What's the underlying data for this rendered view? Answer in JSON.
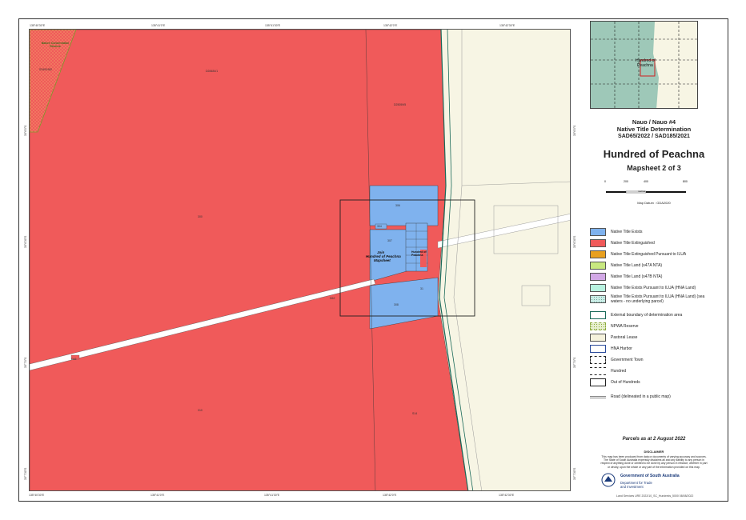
{
  "map": {
    "ticks_top": [
      "135°40'30\"E",
      "135°41'0\"E",
      "135°41'30\"E",
      "135°42'0\"E",
      "135°42'30\"E"
    ],
    "ticks_bottom": [
      "135°40'30\"E",
      "135°41'0\"E",
      "135°41'30\"E",
      "135°42'0\"E",
      "135°42'30\"E"
    ],
    "ticks_left": [
      "33°6'0\"S",
      "33°6'30\"S",
      "33°7'0\"S",
      "33°7'30\"S"
    ],
    "ticks_right": [
      "33°6'0\"S",
      "33°6'30\"S",
      "33°7'0\"S",
      "33°7'30\"S"
    ],
    "parcel_labels": {
      "reserve": "Nature Conservation Reserve",
      "top_left": "S3400462",
      "top_mid": "D28484/1",
      "upper_center": "D25059/5",
      "left_large": "300",
      "blue_top": "306",
      "blue_small": "304",
      "blue_mid": "307",
      "blue_bottom": "308",
      "road_label": "D62",
      "lower_left": "310",
      "lower_right": "S14",
      "small_parcel": "31",
      "small_red": "D16"
    },
    "inset_label_line1": "Join",
    "inset_label_line2": "Hundred of Peachna",
    "inset_label_line3": "Mapsheet",
    "inset2_line1": "Hundred of",
    "inset2_line2": "Peachna"
  },
  "panel": {
    "locator_label1": "Hundred of",
    "locator_label2": "Peachna",
    "title1": "Nauo / Nauo #4",
    "title2": "Native Title Determination",
    "case": "SAD65/2022 / SAD185/2021",
    "hundred": "Hundred of Peachna",
    "mapsheet": "Mapsheet 2 of 3",
    "scale_ticks": [
      "0",
      "200",
      "400",
      "800"
    ],
    "scale_unit": "metres",
    "datum": "Map Datum : GDA2020",
    "legend": [
      {
        "label": "Native Title Exists",
        "color": "#7fb2ee"
      },
      {
        "label": "Native Title Extinguished",
        "color": "#f05a5a"
      },
      {
        "label": "Native Title Extinguished Pursuant to ILUA",
        "color": "#e8a020"
      },
      {
        "label": "Native Title Land (s47A NTA)",
        "color": "#c8e880"
      },
      {
        "label": "Native Title Land (s47B NTA)",
        "color": "#d2a8e6"
      },
      {
        "label": "Native Title Exists Pursuant to ILUA (HNA Land)",
        "color": "#b8f2e0"
      },
      {
        "label": "Native Title Exists Pursuant to ILUA (HNA Land) (sea waters - no underlying parcel)",
        "color": "#cdeee8"
      },
      {
        "label": "External boundary of determination area",
        "color": "#1a6a5a"
      },
      {
        "label": "NPWA Reserve",
        "color": "#e8f0d0"
      },
      {
        "label": "Pastoral Lease",
        "color": "#f5f2dc"
      },
      {
        "label": "HNA Harbor",
        "color": "#2a4a9a"
      },
      {
        "label": "Government Town",
        "color": "#222222"
      },
      {
        "label": "Hundred",
        "color": "#222222"
      },
      {
        "label": "Out of Hundreds",
        "color": "#222222"
      },
      {
        "label": "Road (delineated in a public map)",
        "color": "#888888"
      }
    ],
    "parcels_date": "Parcels as at 2 August 2022",
    "disclaimer_title": "DISCLAIMER",
    "disclaimer_text": "This map has been produced from data or documents of varying accuracy and sources. The State of South Australia expressly disclaims all and any liability to any person in respect of anything done or omitted to be done by any person in reliance, whether in part or wholly, upon the whole or any part of the information provided on this map.",
    "gov_name": "Government of South Australia",
    "dept1": "Department for Trade",
    "dept2": "and Investment",
    "footer": "Land Services URE  2022/10_SC_Hundreds_5000 08/08/2022"
  },
  "colors": {
    "extinguished": "#f05a5a",
    "exists": "#7fb2ee",
    "pastoral": "#f7f5e4",
    "boundary": "#1a6a5a",
    "reserve": "#e07a3a"
  }
}
